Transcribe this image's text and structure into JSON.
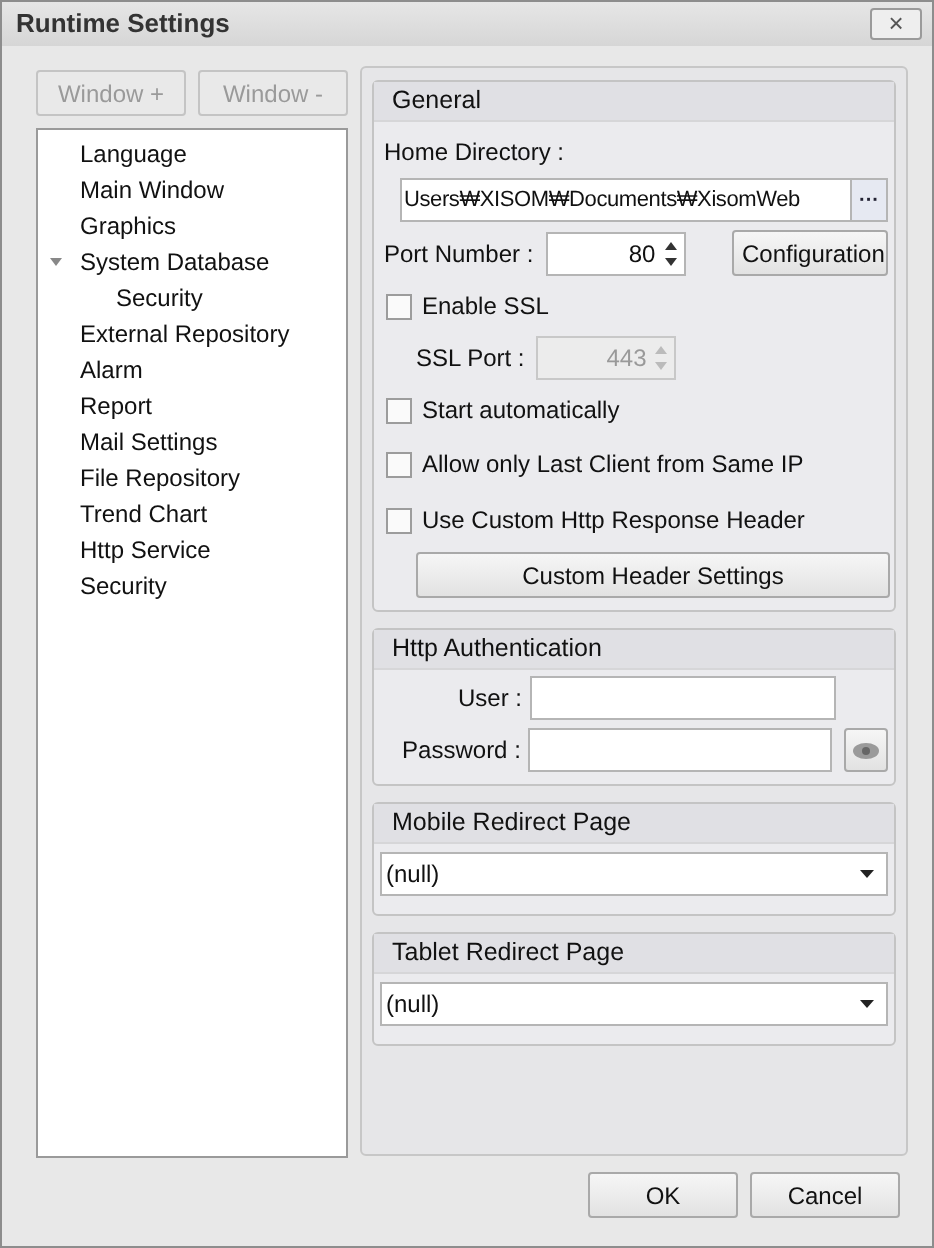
{
  "window": {
    "title": "Runtime Settings",
    "close": "×"
  },
  "window_buttons": [
    {
      "label": "Window +",
      "disabled": true
    },
    {
      "label": "Window -",
      "disabled": true
    }
  ],
  "tree": [
    {
      "label": "Language"
    },
    {
      "label": "Main Window"
    },
    {
      "label": "Graphics"
    },
    {
      "label": "System Database",
      "expanded": true,
      "children": [
        {
          "label": "Security"
        }
      ]
    },
    {
      "label": "External Repository"
    },
    {
      "label": "Alarm"
    },
    {
      "label": "Report"
    },
    {
      "label": "Mail Settings"
    },
    {
      "label": "File Repository"
    },
    {
      "label": "Trend Chart"
    },
    {
      "label": "Http Service"
    },
    {
      "label": "Security"
    }
  ],
  "general": {
    "title": "General",
    "home_label": "Home Directory :",
    "home_value": "Users₩XISOM₩Documents₩XisomWeb",
    "browse": "···",
    "port_label": "Port Number :",
    "port_value": "80",
    "configuration": "Configuration",
    "enable_ssl": {
      "label": "Enable SSL",
      "checked": false
    },
    "ssl_port_label": "SSL Port :",
    "ssl_port_value": "443",
    "ssl_port_disabled": true,
    "options": [
      {
        "label": "Start automatically",
        "checked": false
      },
      {
        "label": "Allow only Last Client from Same IP",
        "checked": false
      },
      {
        "label": "Use Custom Http Response Header",
        "checked": false
      }
    ],
    "custom_header_button": "Custom Header Settings"
  },
  "http_auth": {
    "title": "Http Authentication",
    "user_label": "User :",
    "password_label": "Password :"
  },
  "redirects": [
    {
      "title": "Mobile Redirect Page",
      "value": "(null)"
    },
    {
      "title": "Tablet Redirect Page",
      "value": "(null)"
    }
  ],
  "buttons": [
    "OK",
    "Cancel"
  ]
}
